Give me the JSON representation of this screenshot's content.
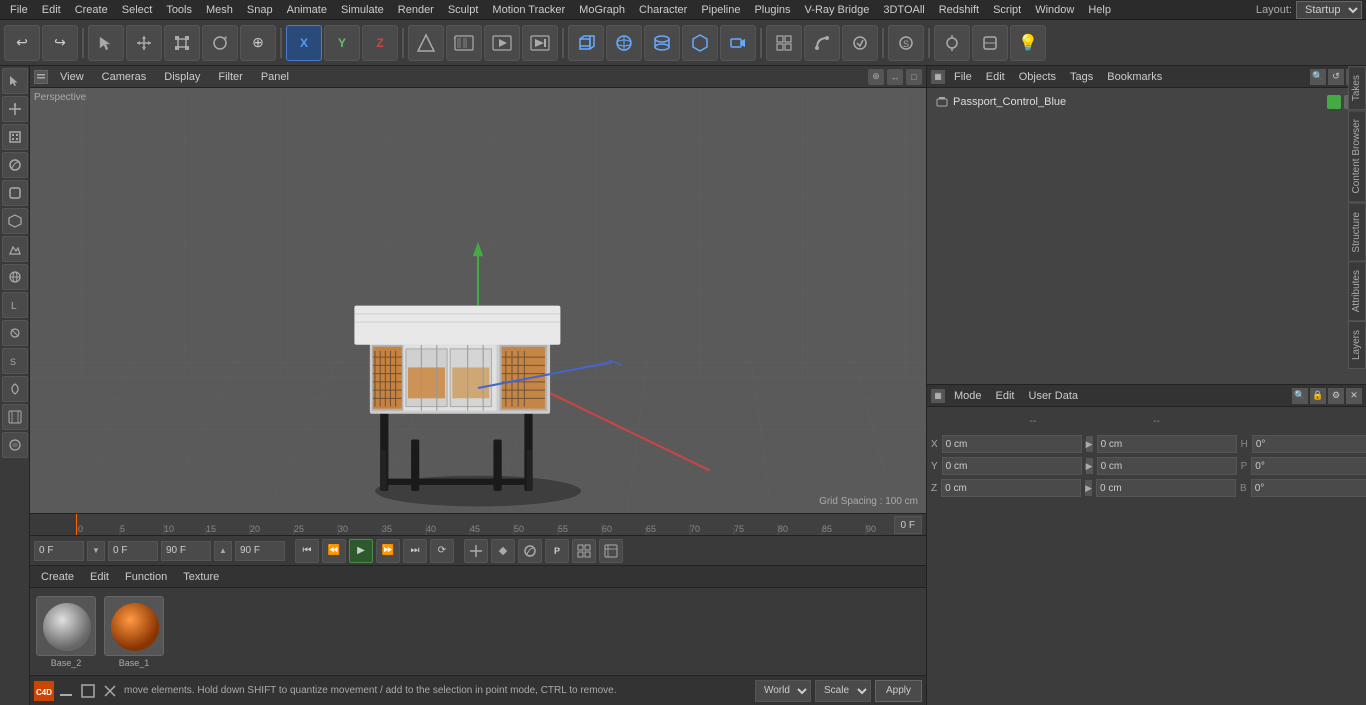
{
  "menubar": {
    "items": [
      "File",
      "Edit",
      "Create",
      "Select",
      "Tools",
      "Mesh",
      "Snap",
      "Animate",
      "Simulate",
      "Render",
      "Sculpt",
      "Motion Tracker",
      "MoGraph",
      "Character",
      "Pipeline",
      "Plugins",
      "V-Ray Bridge",
      "3DTOAll",
      "Redshift",
      "Script",
      "Window",
      "Help"
    ],
    "layout_label": "Layout:",
    "layout_value": "Startup"
  },
  "toolbar": {
    "undo_label": "↩",
    "redo_label": "↪",
    "tools": [
      "⊕",
      "✛",
      "□",
      "↺",
      "⊕"
    ],
    "axis": [
      "X",
      "Y",
      "Z"
    ],
    "shapes": [
      "□",
      "▷",
      "⬡",
      "↺",
      "⊕"
    ],
    "camera_icons": [
      "▦",
      "▷",
      "▦",
      "⊙",
      "▽",
      "●"
    ],
    "light_icon": "💡"
  },
  "viewport": {
    "header_items": [
      "View",
      "Cameras",
      "Display",
      "Filter",
      "Panel"
    ],
    "perspective_label": "Perspective",
    "grid_spacing": "Grid Spacing : 100 cm"
  },
  "timeline": {
    "markers": [
      "0",
      "5",
      "10",
      "15",
      "20",
      "25",
      "30",
      "35",
      "40",
      "45",
      "50",
      "55",
      "60",
      "65",
      "70",
      "75",
      "80",
      "85",
      "90"
    ],
    "current_frame": "0 F",
    "end_frame": "90 F"
  },
  "transport": {
    "start_field": "0 F",
    "current_field": "0 F",
    "end_field": "90 F",
    "end2_field": "90 F",
    "buttons": [
      "⏮",
      "⏪",
      "⏯",
      "⏩",
      "⏭",
      "⟳"
    ],
    "extra_buttons": [
      "✛",
      "□",
      "↺",
      "P",
      "▦",
      "▦"
    ]
  },
  "objects_panel": {
    "title": "Objects",
    "toolbar": [
      "File",
      "Edit",
      "Objects",
      "Tags",
      "Bookmarks"
    ],
    "items": [
      {
        "name": "Passport_Control_Blue",
        "color": "#44aa44"
      }
    ]
  },
  "attributes_panel": {
    "toolbar": [
      "Mode",
      "Edit",
      "User Data"
    ],
    "coords": {
      "x_pos": "0 cm",
      "y_pos": "0 cm",
      "z_pos": "0 cm",
      "x_rot": "0°",
      "y_rot": "0°",
      "z_rot": "0°",
      "x_scale": "0 cm",
      "y_scale": "0 cm",
      "z_scale": "0 cm",
      "p": "0°",
      "b": "0°",
      "h": "0°"
    },
    "col_labels": [
      "--",
      "--"
    ]
  },
  "material_panel": {
    "toolbar": [
      "Create",
      "Edit",
      "Function",
      "Texture"
    ],
    "materials": [
      {
        "name": "Base_2"
      },
      {
        "name": "Base_1"
      }
    ]
  },
  "info_bar": {
    "text": "move elements. Hold down SHIFT to quantize movement / add to the selection in point mode, CTRL to remove.",
    "world_label": "World",
    "scale_label": "Scale",
    "apply_label": "Apply"
  },
  "side_tabs": [
    "Takes",
    "Content Browser",
    "Structure",
    "Attributes",
    "Layers"
  ]
}
